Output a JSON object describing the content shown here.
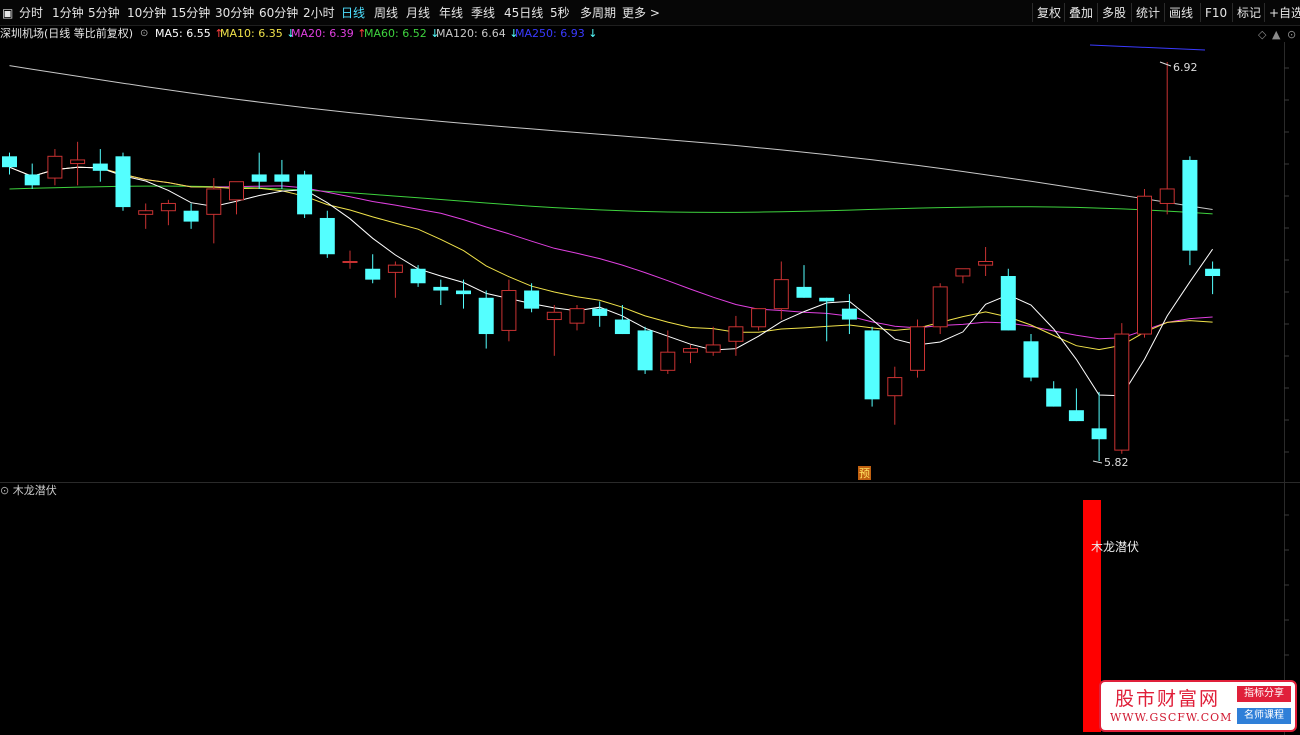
{
  "toolbar": {
    "left_icon": "▣",
    "periods": [
      "分时",
      "1分钟",
      "5分钟",
      "10分钟",
      "15分钟",
      "30分钟",
      "60分钟",
      "2小时",
      "日线",
      "周线",
      "月线",
      "年线",
      "季线",
      "45日线",
      "5秒",
      "多周期",
      "更多 >"
    ],
    "active_period": "日线",
    "right": [
      "复权",
      "叠加",
      "多股",
      "统计",
      "画线",
      "F10",
      "标记",
      "+自选"
    ]
  },
  "ma_bar": {
    "stock_title": "深圳机场(日线 等比前复权)",
    "items": [
      {
        "label": "MA5: 6.55",
        "arrow": "↑",
        "color": "#ffffff"
      },
      {
        "label": "MA10: 6.35",
        "arrow": "↓",
        "color": "#f0e24a"
      },
      {
        "label": "MA20: 6.39",
        "arrow": "↑",
        "color": "#e040e0"
      },
      {
        "label": "MA60: 6.52",
        "arrow": "↓",
        "color": "#3ed23e"
      },
      {
        "label": "MA120: 6.64",
        "arrow": "↓",
        "color": "#c8c8c8"
      },
      {
        "label": "MA250: 6.93",
        "arrow": "↓",
        "color": "#3a3aff"
      }
    ],
    "right_icons": [
      "diamond-icon",
      "up-arrow-icon",
      "settings-icon"
    ]
  },
  "chart_data": {
    "type": "candlestick",
    "high_label": "6.92",
    "low_label": "5.82",
    "forecast_marker": "预",
    "ma_colors": {
      "ma5": "#ffffff",
      "ma10": "#f0e24a",
      "ma20": "#e040e0",
      "ma60": "#3ed23e",
      "ma120": "#c8c8c8",
      "ma250": "#3a3aff"
    },
    "up_color": "#c83232",
    "down_color": "#54ffff",
    "candles": [
      [
        6.66,
        6.67,
        6.61,
        6.63
      ],
      [
        6.61,
        6.64,
        6.57,
        6.58
      ],
      [
        6.6,
        6.68,
        6.58,
        6.66
      ],
      [
        6.64,
        6.7,
        6.58,
        6.65
      ],
      [
        6.64,
        6.68,
        6.59,
        6.62
      ],
      [
        6.66,
        6.67,
        6.51,
        6.52
      ],
      [
        6.5,
        6.53,
        6.46,
        6.51
      ],
      [
        6.51,
        6.54,
        6.47,
        6.53
      ],
      [
        6.51,
        6.53,
        6.46,
        6.48
      ],
      [
        6.5,
        6.6,
        6.42,
        6.57
      ],
      [
        6.54,
        6.59,
        6.5,
        6.59
      ],
      [
        6.61,
        6.67,
        6.57,
        6.59
      ],
      [
        6.61,
        6.65,
        6.57,
        6.59
      ],
      [
        6.61,
        6.62,
        6.49,
        6.5
      ],
      [
        6.49,
        6.51,
        6.38,
        6.39
      ],
      [
        6.37,
        6.4,
        6.35,
        6.37
      ],
      [
        6.35,
        6.39,
        6.31,
        6.32
      ],
      [
        6.34,
        6.37,
        6.27,
        6.36
      ],
      [
        6.35,
        6.36,
        6.3,
        6.31
      ],
      [
        6.3,
        6.32,
        6.25,
        6.29
      ],
      [
        6.29,
        6.32,
        6.24,
        6.28
      ],
      [
        6.27,
        6.29,
        6.13,
        6.17
      ],
      [
        6.18,
        6.32,
        6.15,
        6.29
      ],
      [
        6.29,
        6.31,
        6.23,
        6.24
      ],
      [
        6.21,
        6.25,
        6.11,
        6.23
      ],
      [
        6.2,
        6.25,
        6.18,
        6.24
      ],
      [
        6.24,
        6.26,
        6.19,
        6.22
      ],
      [
        6.21,
        6.25,
        6.17,
        6.17
      ],
      [
        6.18,
        6.19,
        6.06,
        6.07
      ],
      [
        6.07,
        6.18,
        6.06,
        6.12
      ],
      [
        6.12,
        6.14,
        6.09,
        6.13
      ],
      [
        6.12,
        6.19,
        6.11,
        6.14
      ],
      [
        6.15,
        6.22,
        6.11,
        6.19
      ],
      [
        6.19,
        6.24,
        6.18,
        6.24
      ],
      [
        6.24,
        6.37,
        6.21,
        6.32
      ],
      [
        6.3,
        6.36,
        6.27,
        6.27
      ],
      [
        6.27,
        6.27,
        6.15,
        6.26
      ],
      [
        6.24,
        6.28,
        6.17,
        6.21
      ],
      [
        6.18,
        6.19,
        5.97,
        5.99
      ],
      [
        6.0,
        6.08,
        5.92,
        6.05
      ],
      [
        6.07,
        6.21,
        6.05,
        6.19
      ],
      [
        6.19,
        6.31,
        6.17,
        6.3
      ],
      [
        6.33,
        6.35,
        6.31,
        6.35
      ],
      [
        6.36,
        6.41,
        6.33,
        6.37
      ],
      [
        6.33,
        6.35,
        6.18,
        6.18
      ],
      [
        6.15,
        6.17,
        6.04,
        6.05
      ],
      [
        6.02,
        6.04,
        5.97,
        5.97
      ],
      [
        5.96,
        6.02,
        5.93,
        5.93
      ],
      [
        5.91,
        6.01,
        5.82,
        5.88
      ],
      [
        5.85,
        6.2,
        5.84,
        6.17
      ],
      [
        6.17,
        6.57,
        6.16,
        6.55
      ],
      [
        6.53,
        6.92,
        6.5,
        6.57
      ],
      [
        6.65,
        6.66,
        6.36,
        6.4
      ],
      [
        6.35,
        6.37,
        6.28,
        6.33
      ]
    ]
  },
  "indicator": {
    "name": "木龙潜伏",
    "signal_label": "木龙潜伏"
  },
  "watermark": {
    "title": "股市财富网",
    "url": "WWW.GSCFW.COM",
    "tag1": "指标分享",
    "tag2": "名师课程"
  }
}
